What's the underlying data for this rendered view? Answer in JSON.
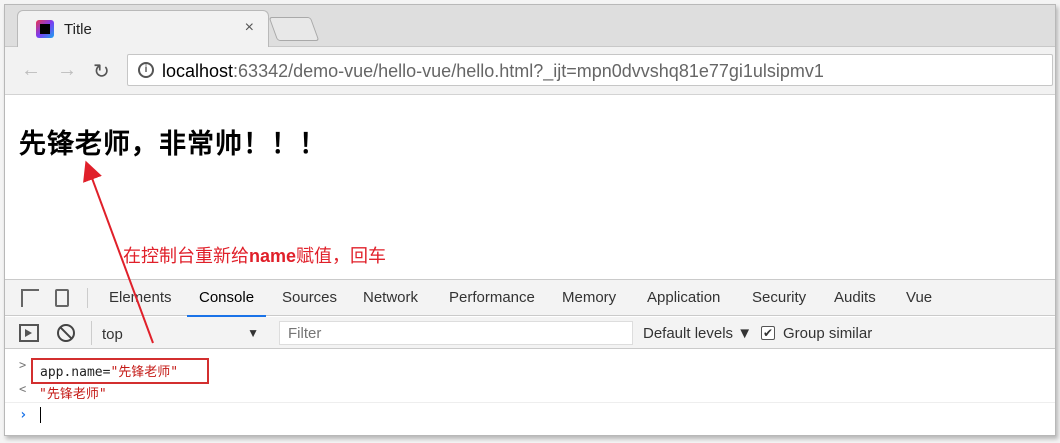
{
  "browser": {
    "tab_title": "Title",
    "tab_close": "×",
    "url_host": "localhost",
    "url_rest": ":63342/demo-vue/hello-vue/hello.html?_ijt=mpn0dvvshq81e77gi1ulsipmv1",
    "back_icon": "←",
    "forward_icon": "→",
    "reload_icon": "↻",
    "info_icon": "i"
  },
  "page": {
    "heading": "先锋老师，非常帅！！！"
  },
  "annotation": {
    "prefix": "在控制台重新给",
    "keyword": "name",
    "suffix": "赋值，回车",
    "color": "#e0202a"
  },
  "devtools": {
    "tabs": [
      "Elements",
      "Console",
      "Sources",
      "Network",
      "Performance",
      "Memory",
      "Application",
      "Security",
      "Audits",
      "Vue"
    ],
    "active_tab": "Console",
    "context": "top",
    "context_arrow": "▼",
    "filter_placeholder": "Filter",
    "levels": "Default levels ▼",
    "group_similar": "Group similar",
    "group_checked": "✔",
    "accent_color": "#1a73e8"
  },
  "console": {
    "command_prefix": "app.name=",
    "command_string": "\"先锋老师\"",
    "result": "\"先锋老师\"",
    "input_prompt": "›",
    "command_prompt": ">",
    "result_prompt": "<"
  }
}
